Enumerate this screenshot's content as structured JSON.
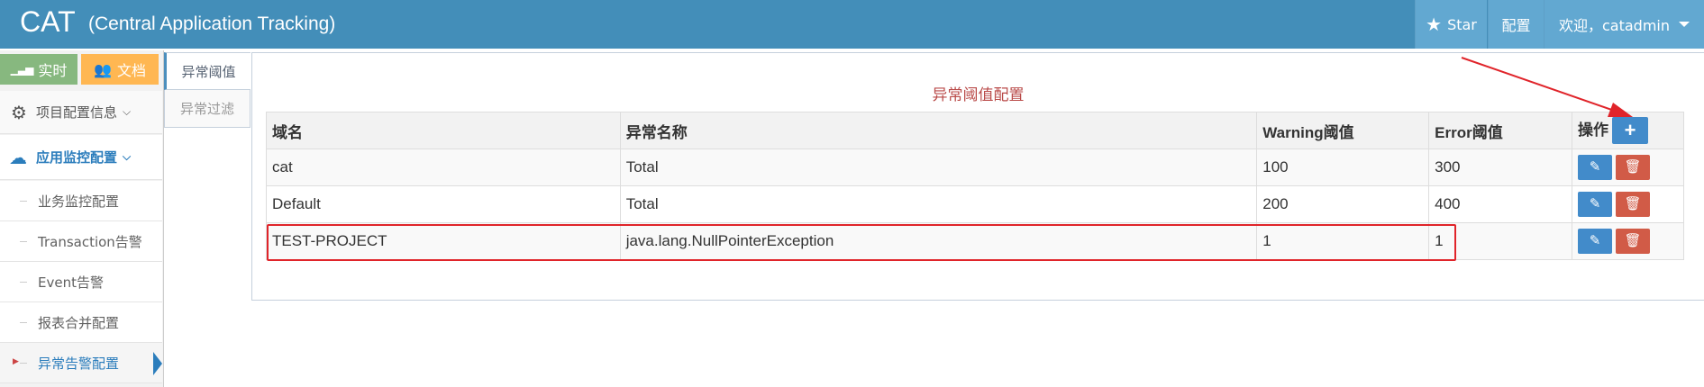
{
  "header": {
    "brand": "CAT",
    "subtitle": "(Central Application Tracking)",
    "star_label": "Star",
    "config_label": "配置",
    "user_label": "欢迎，catadmin"
  },
  "sidebar": {
    "realtime_label": "实时",
    "docs_label": "文档",
    "project_config": "项目配置信息",
    "app_monitor": "应用监控配置",
    "items": [
      {
        "label": "业务监控配置"
      },
      {
        "label": "Transaction告警"
      },
      {
        "label": "Event告警"
      },
      {
        "label": "报表合并配置"
      },
      {
        "label": "异常告警配置"
      }
    ]
  },
  "tabs": {
    "threshold": "异常阈值",
    "filter": "异常过滤"
  },
  "panel": {
    "title": "异常阈值配置",
    "columns": [
      "域名",
      "异常名称",
      "Warning阈值",
      "Error阈值",
      "操作"
    ],
    "rows": [
      {
        "domain": "cat",
        "name": "Total",
        "warning": "100",
        "error": "300"
      },
      {
        "domain": "Default",
        "name": "Total",
        "warning": "200",
        "error": "400"
      },
      {
        "domain": "TEST-PROJECT",
        "name": "java.lang.NullPointerException",
        "warning": "1",
        "error": "1"
      }
    ]
  },
  "colors": {
    "header_bg": "#438eb9",
    "title_red": "#b94a48",
    "highlight_red": "#e0242a",
    "button_blue": "#428bca",
    "button_red": "#d15b47"
  }
}
